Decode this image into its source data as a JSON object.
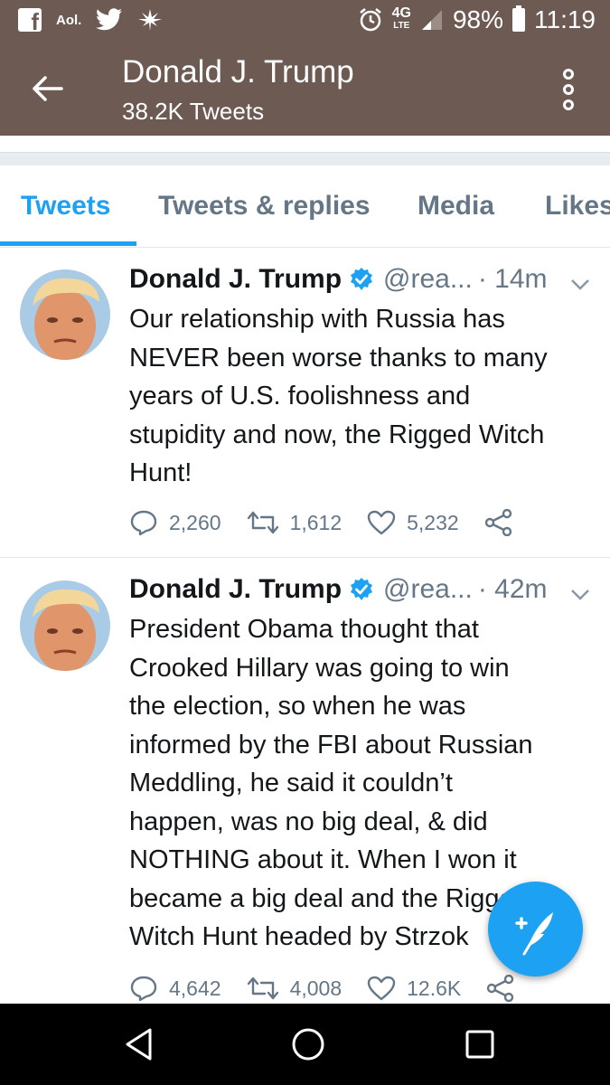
{
  "status_bar": {
    "battery": "98%",
    "time": "11:19",
    "aol_label": "Aol.",
    "network_top": "4G",
    "network_bottom": "LTE",
    "icons": [
      "facebook-icon",
      "aol-icon",
      "twitter-icon",
      "cannabis-icon",
      "alarm-icon",
      "signal-icon",
      "battery-icon"
    ]
  },
  "header": {
    "title": "Donald J. Trump",
    "subtitle": "38.2K Tweets"
  },
  "tabs": [
    {
      "label": "Tweets",
      "active": true
    },
    {
      "label": "Tweets & replies",
      "active": false
    },
    {
      "label": "Media",
      "active": false
    },
    {
      "label": "Likes",
      "active": false
    }
  ],
  "tweets": [
    {
      "name": "Donald J. Trump",
      "handle": "@rea...",
      "time": "· 14m",
      "lines": [
        "Our relationship with Russia has",
        "NEVER been worse thanks to many",
        "years of U.S. foolishness and",
        "stupidity and now, the Rigged Witch",
        "Hunt!"
      ],
      "replies": "2,260",
      "retweets": "1,612",
      "likes": "5,232"
    },
    {
      "name": "Donald J. Trump",
      "handle": "@rea...",
      "time": "· 42m",
      "lines": [
        "President Obama thought that",
        "Crooked Hillary was going to win",
        "the election, so when he was",
        "informed by the FBI about Russian",
        "Meddling, he said it couldn’t",
        "happen, was no big deal, & did",
        "NOTHING about it. When I won it",
        "became a big deal and the Rigged",
        "Witch Hunt headed by Strzok"
      ],
      "replies": "4,642",
      "retweets": "4,008",
      "likes": "12.6K"
    }
  ],
  "colors": {
    "header_bg": "#6d5a53",
    "accent": "#1da1f2",
    "secondary_text": "#657786"
  }
}
